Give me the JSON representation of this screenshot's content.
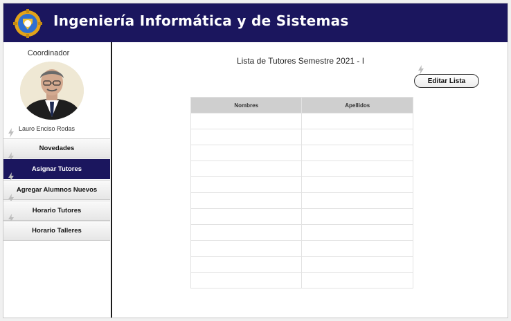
{
  "header": {
    "title": "Ingeniería Informática y de Sistemas",
    "logo_icon": "university-gear-logo-icon",
    "background": "#1b165e"
  },
  "sidebar": {
    "role_label": "Coordinador",
    "user_name": "Lauro Enciso Rodas",
    "items": [
      {
        "label": "Novedades",
        "active": false
      },
      {
        "label": "Asignar Tutores",
        "active": true
      },
      {
        "label": "Agregar Alumnos Nuevos",
        "active": false
      },
      {
        "label": "Horario Tutores",
        "active": false
      },
      {
        "label": "Horario Talleres",
        "active": false
      }
    ]
  },
  "main": {
    "list_title": "Lista de Tutores Semestre 2021 - I",
    "edit_button_label": "Editar Lista",
    "table": {
      "columns": [
        "Nombres",
        "Apellidos"
      ],
      "rows": [
        [
          "",
          ""
        ],
        [
          "",
          ""
        ],
        [
          "",
          ""
        ],
        [
          "",
          ""
        ],
        [
          "",
          ""
        ],
        [
          "",
          ""
        ],
        [
          "",
          ""
        ],
        [
          "",
          ""
        ],
        [
          "",
          ""
        ],
        [
          "",
          ""
        ],
        [
          "",
          ""
        ]
      ]
    }
  }
}
